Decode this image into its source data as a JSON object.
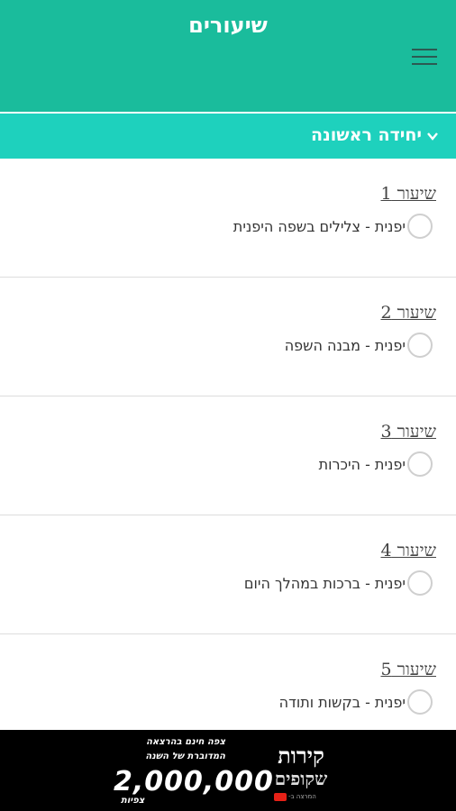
{
  "header": {
    "title": "שיעורים",
    "menu_icon": "hamburger-menu-icon"
  },
  "unit": {
    "title": "יחידה ראשונה",
    "icon": "chevron-down-icon"
  },
  "lessons": [
    {
      "title": "שיעור 1",
      "subtitle": "יפנית - צלילים בשפה היפנית"
    },
    {
      "title": "שיעור 2",
      "subtitle": "יפנית - מבנה השפה"
    },
    {
      "title": "שיעור 3",
      "subtitle": "יפנית - היכרות"
    },
    {
      "title": "שיעור 4",
      "subtitle": "יפנית - ברכות במהלך היום"
    },
    {
      "title": "שיעור 5",
      "subtitle": "יפנית - בקשות ותודה"
    }
  ],
  "ad": {
    "line1": "צפה חינם בהרצאה",
    "line2": "המדוברת של השנה",
    "number": "2,000,000",
    "views": "צפיות",
    "logo_line1": "קירות",
    "logo_line2": "שקופים",
    "logo_small": "המרצה ב-"
  },
  "colors": {
    "header": "#1abc9c",
    "unit_bar": "#1ed1bd"
  }
}
